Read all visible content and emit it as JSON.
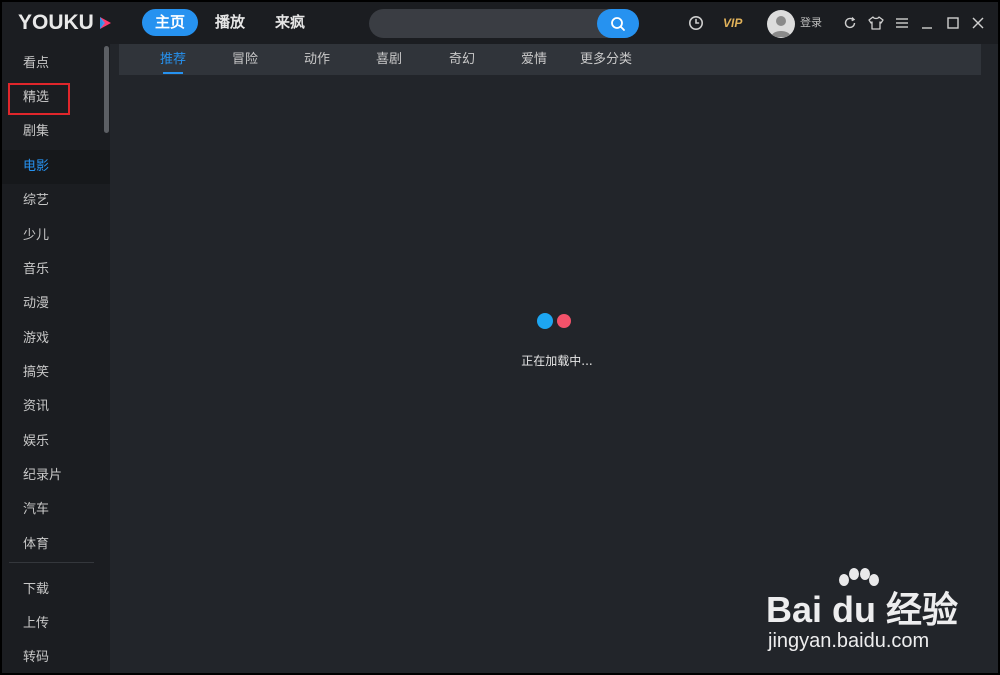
{
  "titlebar": {
    "logo_text": "YOUKU",
    "nav": [
      "主页",
      "播放",
      "来疯"
    ],
    "search_placeholder": "",
    "vip_label": "VIP",
    "login_label": "登录",
    "accent": "#2692f0"
  },
  "sidebar": {
    "items": [
      "看点",
      "精选",
      "剧集",
      "电影",
      "综艺",
      "少儿",
      "音乐",
      "动漫",
      "游戏",
      "搞笑",
      "资讯",
      "娱乐",
      "纪录片",
      "汽车",
      "体育"
    ],
    "active_index": 3,
    "highlighted_index": 1,
    "tools": [
      "下载",
      "上传",
      "转码"
    ]
  },
  "categories": {
    "tabs": [
      "推荐",
      "冒险",
      "动作",
      "喜剧",
      "奇幻",
      "爱情",
      "更多分类"
    ],
    "active_index": 0
  },
  "loading": {
    "text": "正在加载中...",
    "dot_colors": [
      "#1da6f2",
      "#f2526a"
    ]
  },
  "watermark": {
    "brand": "Bai du 经验",
    "url": "jingyan.baidu.com"
  },
  "icons": [
    "search-icon",
    "history-clock-icon",
    "refresh-icon",
    "skin-shirt-icon",
    "menu-icon",
    "minimize-icon",
    "maximize-icon",
    "close-icon"
  ]
}
